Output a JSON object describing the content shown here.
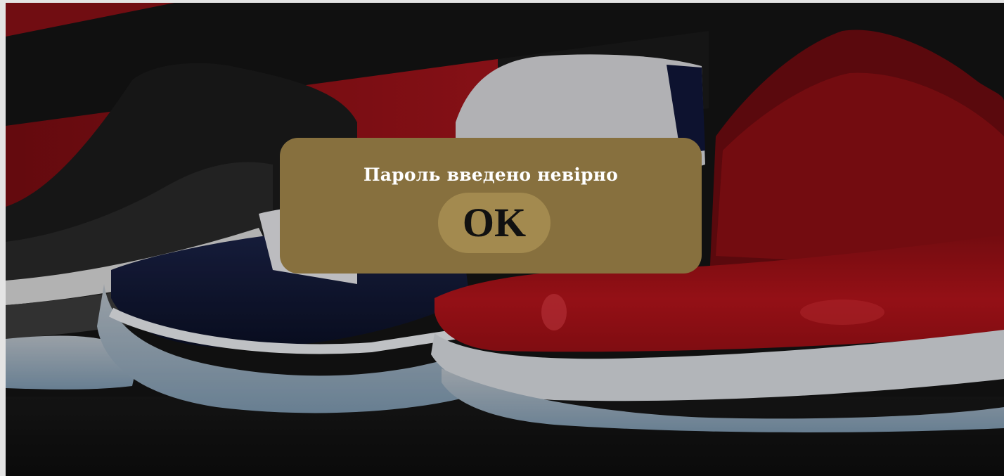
{
  "dialog": {
    "message": "Пароль введено невірно",
    "ok_label": "OK"
  },
  "hero": {
    "image_subject": "sneaker-lineup",
    "colors": {
      "background": "#121212",
      "accent_red": "#a01218",
      "navy": "#0f1631",
      "dialog": "#87703e",
      "button": "#a38a4f"
    }
  }
}
